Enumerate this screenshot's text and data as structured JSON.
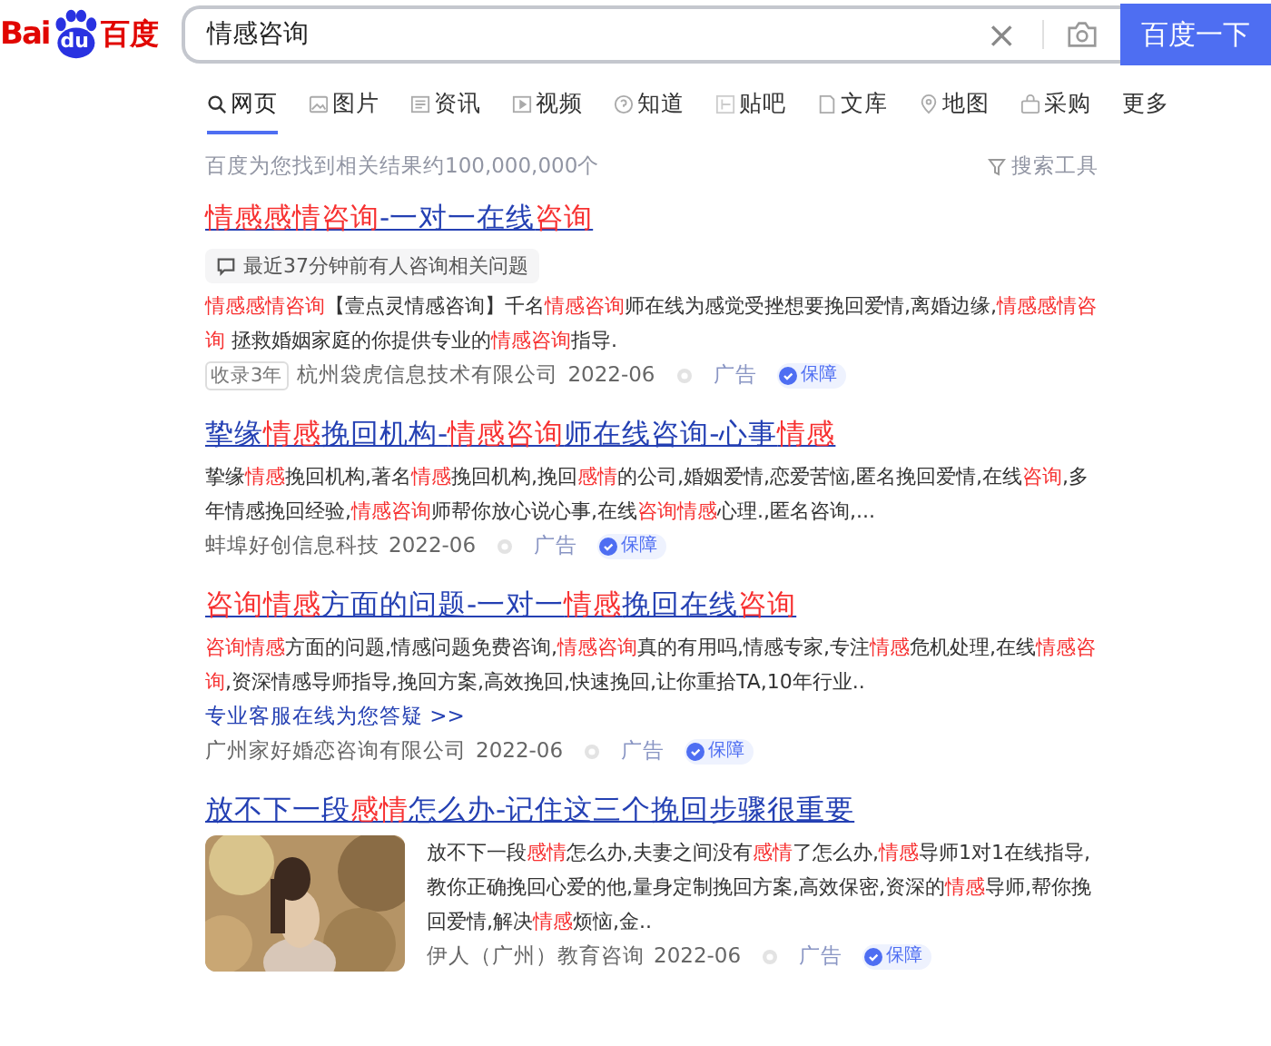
{
  "logo": {
    "left": "Bai",
    "paw": "du",
    "right": "百度"
  },
  "search": {
    "value": "情感咨询",
    "clear": "×",
    "button": "百度一下"
  },
  "tabs": [
    {
      "label": "网页",
      "selected": true
    },
    {
      "label": "图片",
      "selected": false
    },
    {
      "label": "资讯",
      "selected": false
    },
    {
      "label": "视频",
      "selected": false
    },
    {
      "label": "知道",
      "selected": false
    },
    {
      "label": "贴吧",
      "selected": false
    },
    {
      "label": "文库",
      "selected": false
    },
    {
      "label": "地图",
      "selected": false
    },
    {
      "label": "采购",
      "selected": false
    },
    {
      "label": "更多",
      "selected": false
    }
  ],
  "result_count": "百度为您找到相关结果约100,000,000个",
  "search_tools": "搜索工具",
  "results": [
    {
      "title": [
        {
          "text": "情感感情咨询",
          "highlight": true
        },
        {
          "text": "-一对一在线",
          "highlight": false
        },
        {
          "text": "咨询",
          "highlight": true
        }
      ],
      "recent": "最近37分钟前有人咨询相关问题",
      "snippet": [
        {
          "text": "情感感情咨询",
          "highlight": true
        },
        {
          "text": "【壹点灵情感咨询】千名",
          "highlight": false
        },
        {
          "text": "情感咨询",
          "highlight": true
        },
        {
          "text": "师在线为感觉受挫想要挽回爱情,离婚边缘,",
          "highlight": false
        },
        {
          "text": "情感感情咨询",
          "highlight": true
        },
        {
          "text": " 拯救婚姻家庭的你提供专业的",
          "highlight": false
        },
        {
          "text": "情感咨询",
          "highlight": true
        },
        {
          "text": "指导.",
          "highlight": false
        }
      ],
      "tag": "收录3年",
      "source": "杭州袋虎信息技术有限公司",
      "date": "2022-06",
      "ad": "广告",
      "badge": "保障"
    },
    {
      "title": [
        {
          "text": "挚缘",
          "highlight": false
        },
        {
          "text": "情感",
          "highlight": true
        },
        {
          "text": "挽回机构-",
          "highlight": false
        },
        {
          "text": "情感咨询",
          "highlight": true
        },
        {
          "text": "师在线咨询-心事",
          "highlight": false
        },
        {
          "text": "情感",
          "highlight": true
        }
      ],
      "snippet": [
        {
          "text": "挚缘",
          "highlight": false
        },
        {
          "text": "情感",
          "highlight": true
        },
        {
          "text": "挽回机构,著名",
          "highlight": false
        },
        {
          "text": "情感",
          "highlight": true
        },
        {
          "text": "挽回机构,挽回",
          "highlight": false
        },
        {
          "text": "感情",
          "highlight": true
        },
        {
          "text": "的公司,婚姻爱情,恋爱苦恼,匿名挽回爱情,在线",
          "highlight": false
        },
        {
          "text": "咨询",
          "highlight": true
        },
        {
          "text": ",多年情感挽回经验,",
          "highlight": false
        },
        {
          "text": "情感咨询",
          "highlight": true
        },
        {
          "text": "师帮你放心说心事,在线",
          "highlight": false
        },
        {
          "text": "咨询情感",
          "highlight": true
        },
        {
          "text": "心理.,匿名咨询,...",
          "highlight": false
        }
      ],
      "source": "蚌埠好创信息科技",
      "date": "2022-06",
      "ad": "广告",
      "badge": "保障"
    },
    {
      "title": [
        {
          "text": "咨询情感",
          "highlight": true
        },
        {
          "text": "方面的问题-一对一",
          "highlight": false
        },
        {
          "text": "情感",
          "highlight": true
        },
        {
          "text": "挽回在线",
          "highlight": false
        },
        {
          "text": "咨询",
          "highlight": true
        }
      ],
      "snippet": [
        {
          "text": "咨询情感",
          "highlight": true
        },
        {
          "text": "方面的问题,情感问题免费咨询,",
          "highlight": false
        },
        {
          "text": "情感咨询",
          "highlight": true
        },
        {
          "text": "真的有用吗,情感专家,专注",
          "highlight": false
        },
        {
          "text": "情感",
          "highlight": true
        },
        {
          "text": "危机处理,在线",
          "highlight": false
        },
        {
          "text": "情感咨询",
          "highlight": true
        },
        {
          "text": ",资深情感导师指导,挽回方案,高效挽回,快速挽回,让你重拾TA,10年行业..",
          "highlight": false
        }
      ],
      "link": "专业客服在线为您答疑 >>",
      "source": "广州家好婚恋咨询有限公司",
      "date": "2022-06",
      "ad": "广告",
      "badge": "保障"
    },
    {
      "title": [
        {
          "text": "放不下一段",
          "highlight": false
        },
        {
          "text": "感情",
          "highlight": true
        },
        {
          "text": "怎么办-记住这三个挽回步骤很重要",
          "highlight": false
        }
      ],
      "image": {
        "kind": "picture"
      },
      "snippet": [
        {
          "text": "放不下一段",
          "highlight": false
        },
        {
          "text": "感情",
          "highlight": true
        },
        {
          "text": "怎么办,夫妻之间没有",
          "highlight": false
        },
        {
          "text": "感情",
          "highlight": true
        },
        {
          "text": "了怎么办,",
          "highlight": false
        },
        {
          "text": "情感",
          "highlight": true
        },
        {
          "text": "导师1对1在线指导,教你正确挽回心爱的他,量身定制挽回方案,高效保密,资深的",
          "highlight": false
        },
        {
          "text": "情感",
          "highlight": true
        },
        {
          "text": "导师,帮你挽回爱情,解决",
          "highlight": false
        },
        {
          "text": "情感",
          "highlight": true
        },
        {
          "text": "烦恼,金..",
          "highlight": false
        }
      ],
      "source": "伊人（广州）教育咨询",
      "date": "2022-06",
      "ad": "广告",
      "badge": "保障"
    }
  ]
}
